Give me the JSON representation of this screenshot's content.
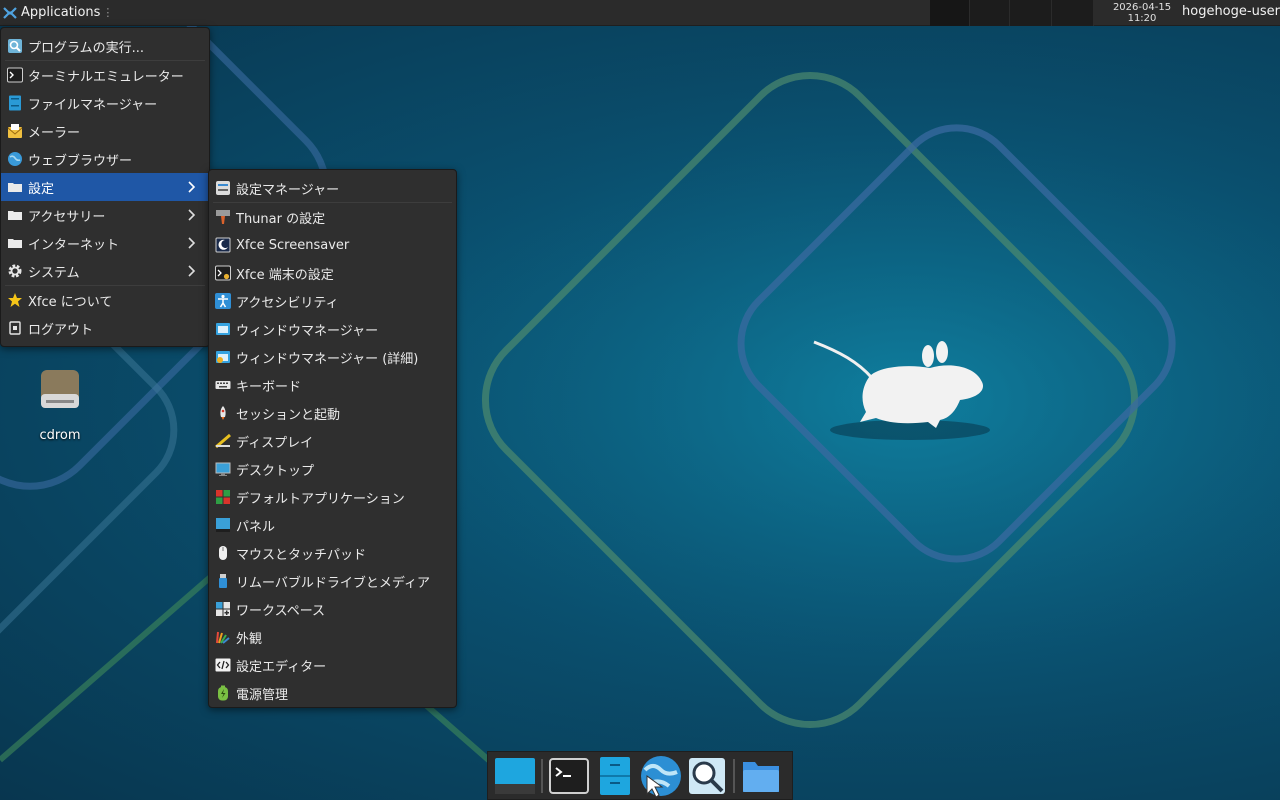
{
  "panel": {
    "apps_label": "Applications",
    "clock_date": "2026-04-15",
    "clock_time": "11:20",
    "user": "hogehoge-user"
  },
  "main_menu": {
    "items": [
      {
        "label": "プログラムの実行...",
        "icon": "run-program-icon"
      },
      {
        "label": "ターミナルエミュレーター",
        "icon": "terminal-icon"
      },
      {
        "label": "ファイルマネージャー",
        "icon": "file-manager-icon"
      },
      {
        "label": "メーラー",
        "icon": "mail-icon"
      },
      {
        "label": "ウェブブラウザー",
        "icon": "web-browser-icon"
      },
      {
        "label": "設定",
        "icon": "folder-icon",
        "submenu": true,
        "active": true
      },
      {
        "label": "アクセサリー",
        "icon": "folder-icon",
        "submenu": true
      },
      {
        "label": "インターネット",
        "icon": "folder-icon",
        "submenu": true
      },
      {
        "label": "システム",
        "icon": "gear-icon",
        "submenu": true
      },
      {
        "label": "Xfce について",
        "icon": "star-icon"
      },
      {
        "label": "ログアウト",
        "icon": "logout-icon"
      }
    ]
  },
  "settings_menu": {
    "items": [
      {
        "label": "設定マネージャー"
      },
      {
        "label": "Thunar の設定"
      },
      {
        "label": "Xfce Screensaver"
      },
      {
        "label": "Xfce 端末の設定"
      },
      {
        "label": "アクセシビリティ"
      },
      {
        "label": "ウィンドウマネージャー"
      },
      {
        "label": "ウィンドウマネージャー (詳細)"
      },
      {
        "label": "キーボード"
      },
      {
        "label": "セッションと起動"
      },
      {
        "label": "ディスプレイ"
      },
      {
        "label": "デスクトップ"
      },
      {
        "label": "デフォルトアプリケーション"
      },
      {
        "label": "パネル"
      },
      {
        "label": "マウスとタッチパッド"
      },
      {
        "label": "リムーバブルドライブとメディア"
      },
      {
        "label": "ワークスペース"
      },
      {
        "label": "外観"
      },
      {
        "label": "設定エディター"
      },
      {
        "label": "電源管理"
      }
    ]
  },
  "desktop": {
    "icons": [
      {
        "label": "cdrom"
      }
    ]
  },
  "dock": {
    "items": [
      "show-desktop-icon",
      "terminal-icon",
      "file-manager-icon",
      "web-browser-icon",
      "app-finder-icon",
      "home-folder-icon"
    ]
  },
  "colors": {
    "accent": "#1f57a6",
    "panel": "#2b2b2b",
    "menu": "#2f2f2f"
  }
}
